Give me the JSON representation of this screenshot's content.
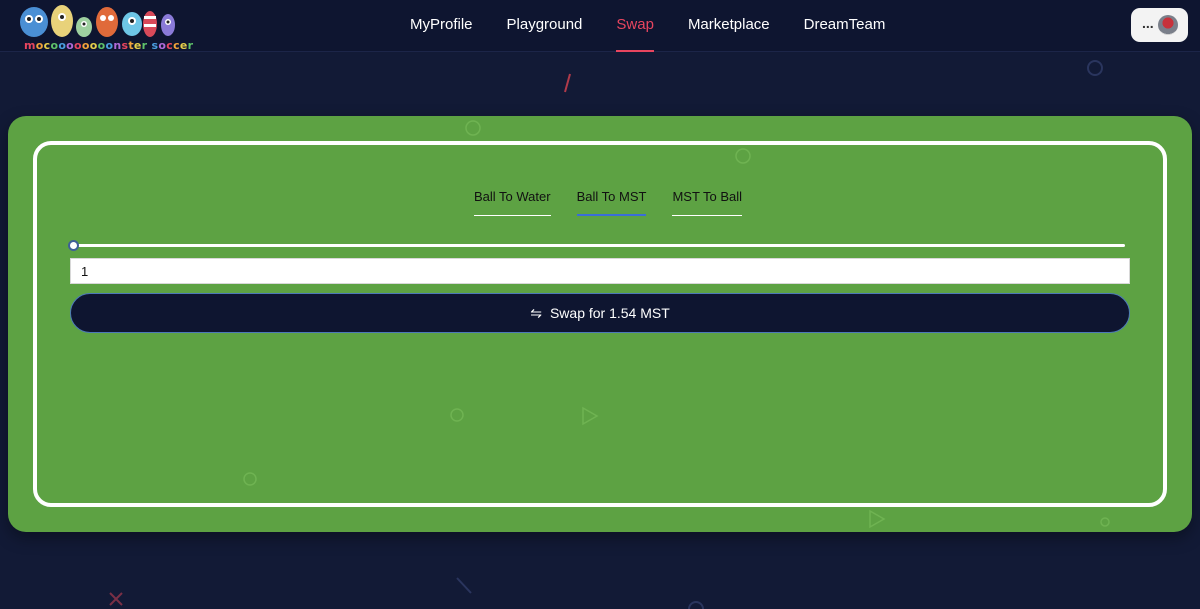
{
  "header": {
    "logo_text": "mocooooooonster soccer",
    "nav": [
      {
        "label": "MyProfile",
        "active": false
      },
      {
        "label": "Playground",
        "active": false
      },
      {
        "label": "Swap",
        "active": true
      },
      {
        "label": "Marketplace",
        "active": false
      },
      {
        "label": "DreamTeam",
        "active": false
      }
    ],
    "profile": {
      "dots": "...",
      "avatar_icon": "avatar-icon"
    }
  },
  "swap": {
    "tabs": [
      {
        "label": "Ball To Water",
        "active": false
      },
      {
        "label": "Ball To MST",
        "active": true
      },
      {
        "label": "MST To Ball",
        "active": false
      }
    ],
    "slider_fraction": 0.0,
    "amount_value": "1",
    "button_label": "Swap for 1.54 MST",
    "button_icon": "swap-arrows-icon"
  },
  "colors": {
    "background": "#121a36",
    "header": "#0e1530",
    "accent_active": "#e8455f",
    "card_green": "#5da243",
    "button_dark": "#0e1530",
    "tab_indicator": "#3a6dd8"
  }
}
